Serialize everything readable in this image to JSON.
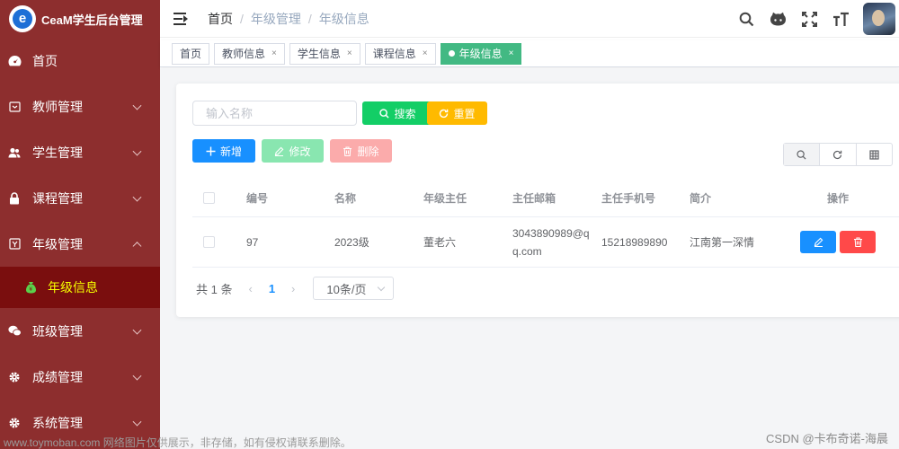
{
  "app": {
    "title": "CeaM学生后台管理",
    "logo_letter": "e"
  },
  "sidebar": {
    "items": [
      {
        "label": "首页",
        "icon": "dashboard-icon",
        "expandable": false
      },
      {
        "label": "教师管理",
        "icon": "teacher-icon",
        "expandable": true
      },
      {
        "label": "学生管理",
        "icon": "student-icon",
        "expandable": true
      },
      {
        "label": "课程管理",
        "icon": "lock-icon",
        "expandable": true
      },
      {
        "label": "年级管理",
        "icon": "grade-icon",
        "expandable": true,
        "expanded": true
      },
      {
        "label": "班级管理",
        "icon": "wechat-icon",
        "expandable": true
      },
      {
        "label": "成绩管理",
        "icon": "gear-icon",
        "expandable": true
      },
      {
        "label": "系统管理",
        "icon": "gear-icon",
        "expandable": true
      }
    ],
    "active_submenu": {
      "label": "年级信息",
      "icon": "money-bag-icon"
    },
    "active_color": "#f7ff00",
    "bg_color": "#8d2e2e"
  },
  "header": {
    "breadcrumb": [
      "首页",
      "年级管理",
      "年级信息"
    ],
    "breadcrumb_sep": "/",
    "icons": [
      "search-icon",
      "github-icon",
      "fullscreen-icon",
      "font-size-icon"
    ]
  },
  "tags": [
    {
      "label": "首页",
      "closable": false,
      "active": false
    },
    {
      "label": "教师信息",
      "closable": true,
      "active": false
    },
    {
      "label": "学生信息",
      "closable": true,
      "active": false
    },
    {
      "label": "课程信息",
      "closable": true,
      "active": false
    },
    {
      "label": "年级信息",
      "closable": true,
      "active": true
    }
  ],
  "tag_close": "×",
  "toolbar": {
    "search_placeholder": "输入名称",
    "search_label": "搜索",
    "reset_label": "重置",
    "add_label": "新增",
    "edit_label": "修改",
    "delete_label": "删除"
  },
  "table": {
    "columns": [
      "编号",
      "名称",
      "年级主任",
      "主任邮箱",
      "主任手机号",
      "简介",
      "操作"
    ],
    "rows": [
      {
        "id": "97",
        "name": "2023级",
        "head": "董老六",
        "email": "3043890989@qq.com",
        "phone": "15218989890",
        "intro": "江南第一深情"
      }
    ]
  },
  "pagination": {
    "total_label": "共 1 条",
    "prev": "‹",
    "current_page": "1",
    "next": "›",
    "page_size": "10条/页"
  },
  "watermark": {
    "left": "www.toymoban.com 网络图片仅供展示，非存储，如有侵权请联系删除。",
    "right": "CSDN @卡布奇诺-海晨"
  }
}
